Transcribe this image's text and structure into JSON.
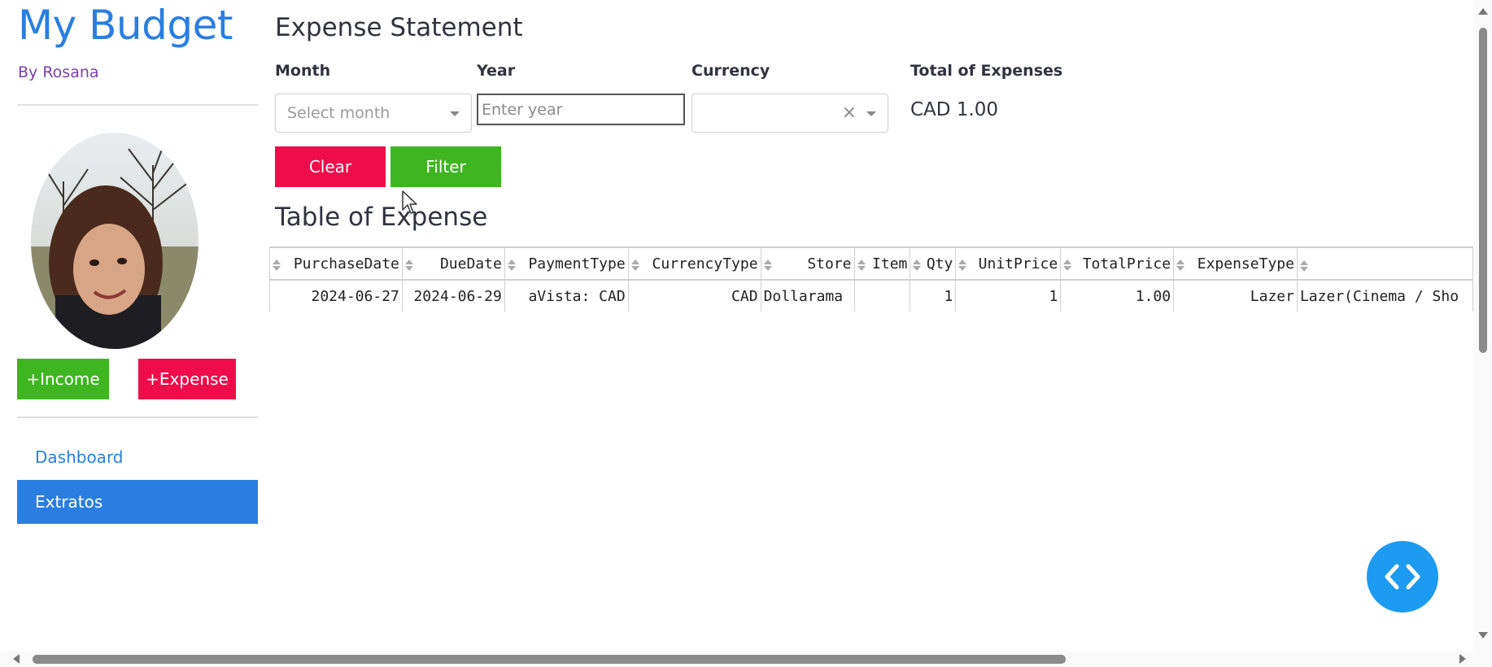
{
  "sidebar": {
    "app_title": "My Budget",
    "author": "By Rosana",
    "income_button": "+Income",
    "expense_button": "+Expense",
    "nav": [
      {
        "label": "Dashboard",
        "active": false
      },
      {
        "label": "Extratos",
        "active": true
      }
    ]
  },
  "main": {
    "title": "Expense Statement",
    "filters": {
      "month_label": "Month",
      "month_placeholder": "Select month",
      "year_label": "Year",
      "year_placeholder": "Enter year",
      "currency_label": "Currency",
      "currency_clear": "×",
      "total_label": "Total of Expenses",
      "total_value": "CAD 1.00"
    },
    "clear_button": "Clear",
    "filter_button": "Filter",
    "table_title": "Table of Expense",
    "table": {
      "columns": [
        "PurchaseDate",
        "DueDate",
        "PaymentType",
        "CurrencyType",
        "Store",
        "Item",
        "Qty",
        "UnitPrice",
        "TotalPrice",
        "ExpenseType",
        ""
      ],
      "rows": [
        [
          "2024-06-27",
          "2024-06-29",
          "aVista: CAD",
          "CAD",
          "Dollarama",
          "",
          "1",
          "1",
          "1.00",
          "Lazer",
          "Lazer(Cinema / Sho"
        ]
      ]
    }
  },
  "colors": {
    "accent": "#2a7ee0",
    "success": "#3fb521",
    "danger": "#ee0d4a",
    "fab": "#1d9bf0"
  },
  "icons": {
    "fab": "code-brackets-icon"
  }
}
